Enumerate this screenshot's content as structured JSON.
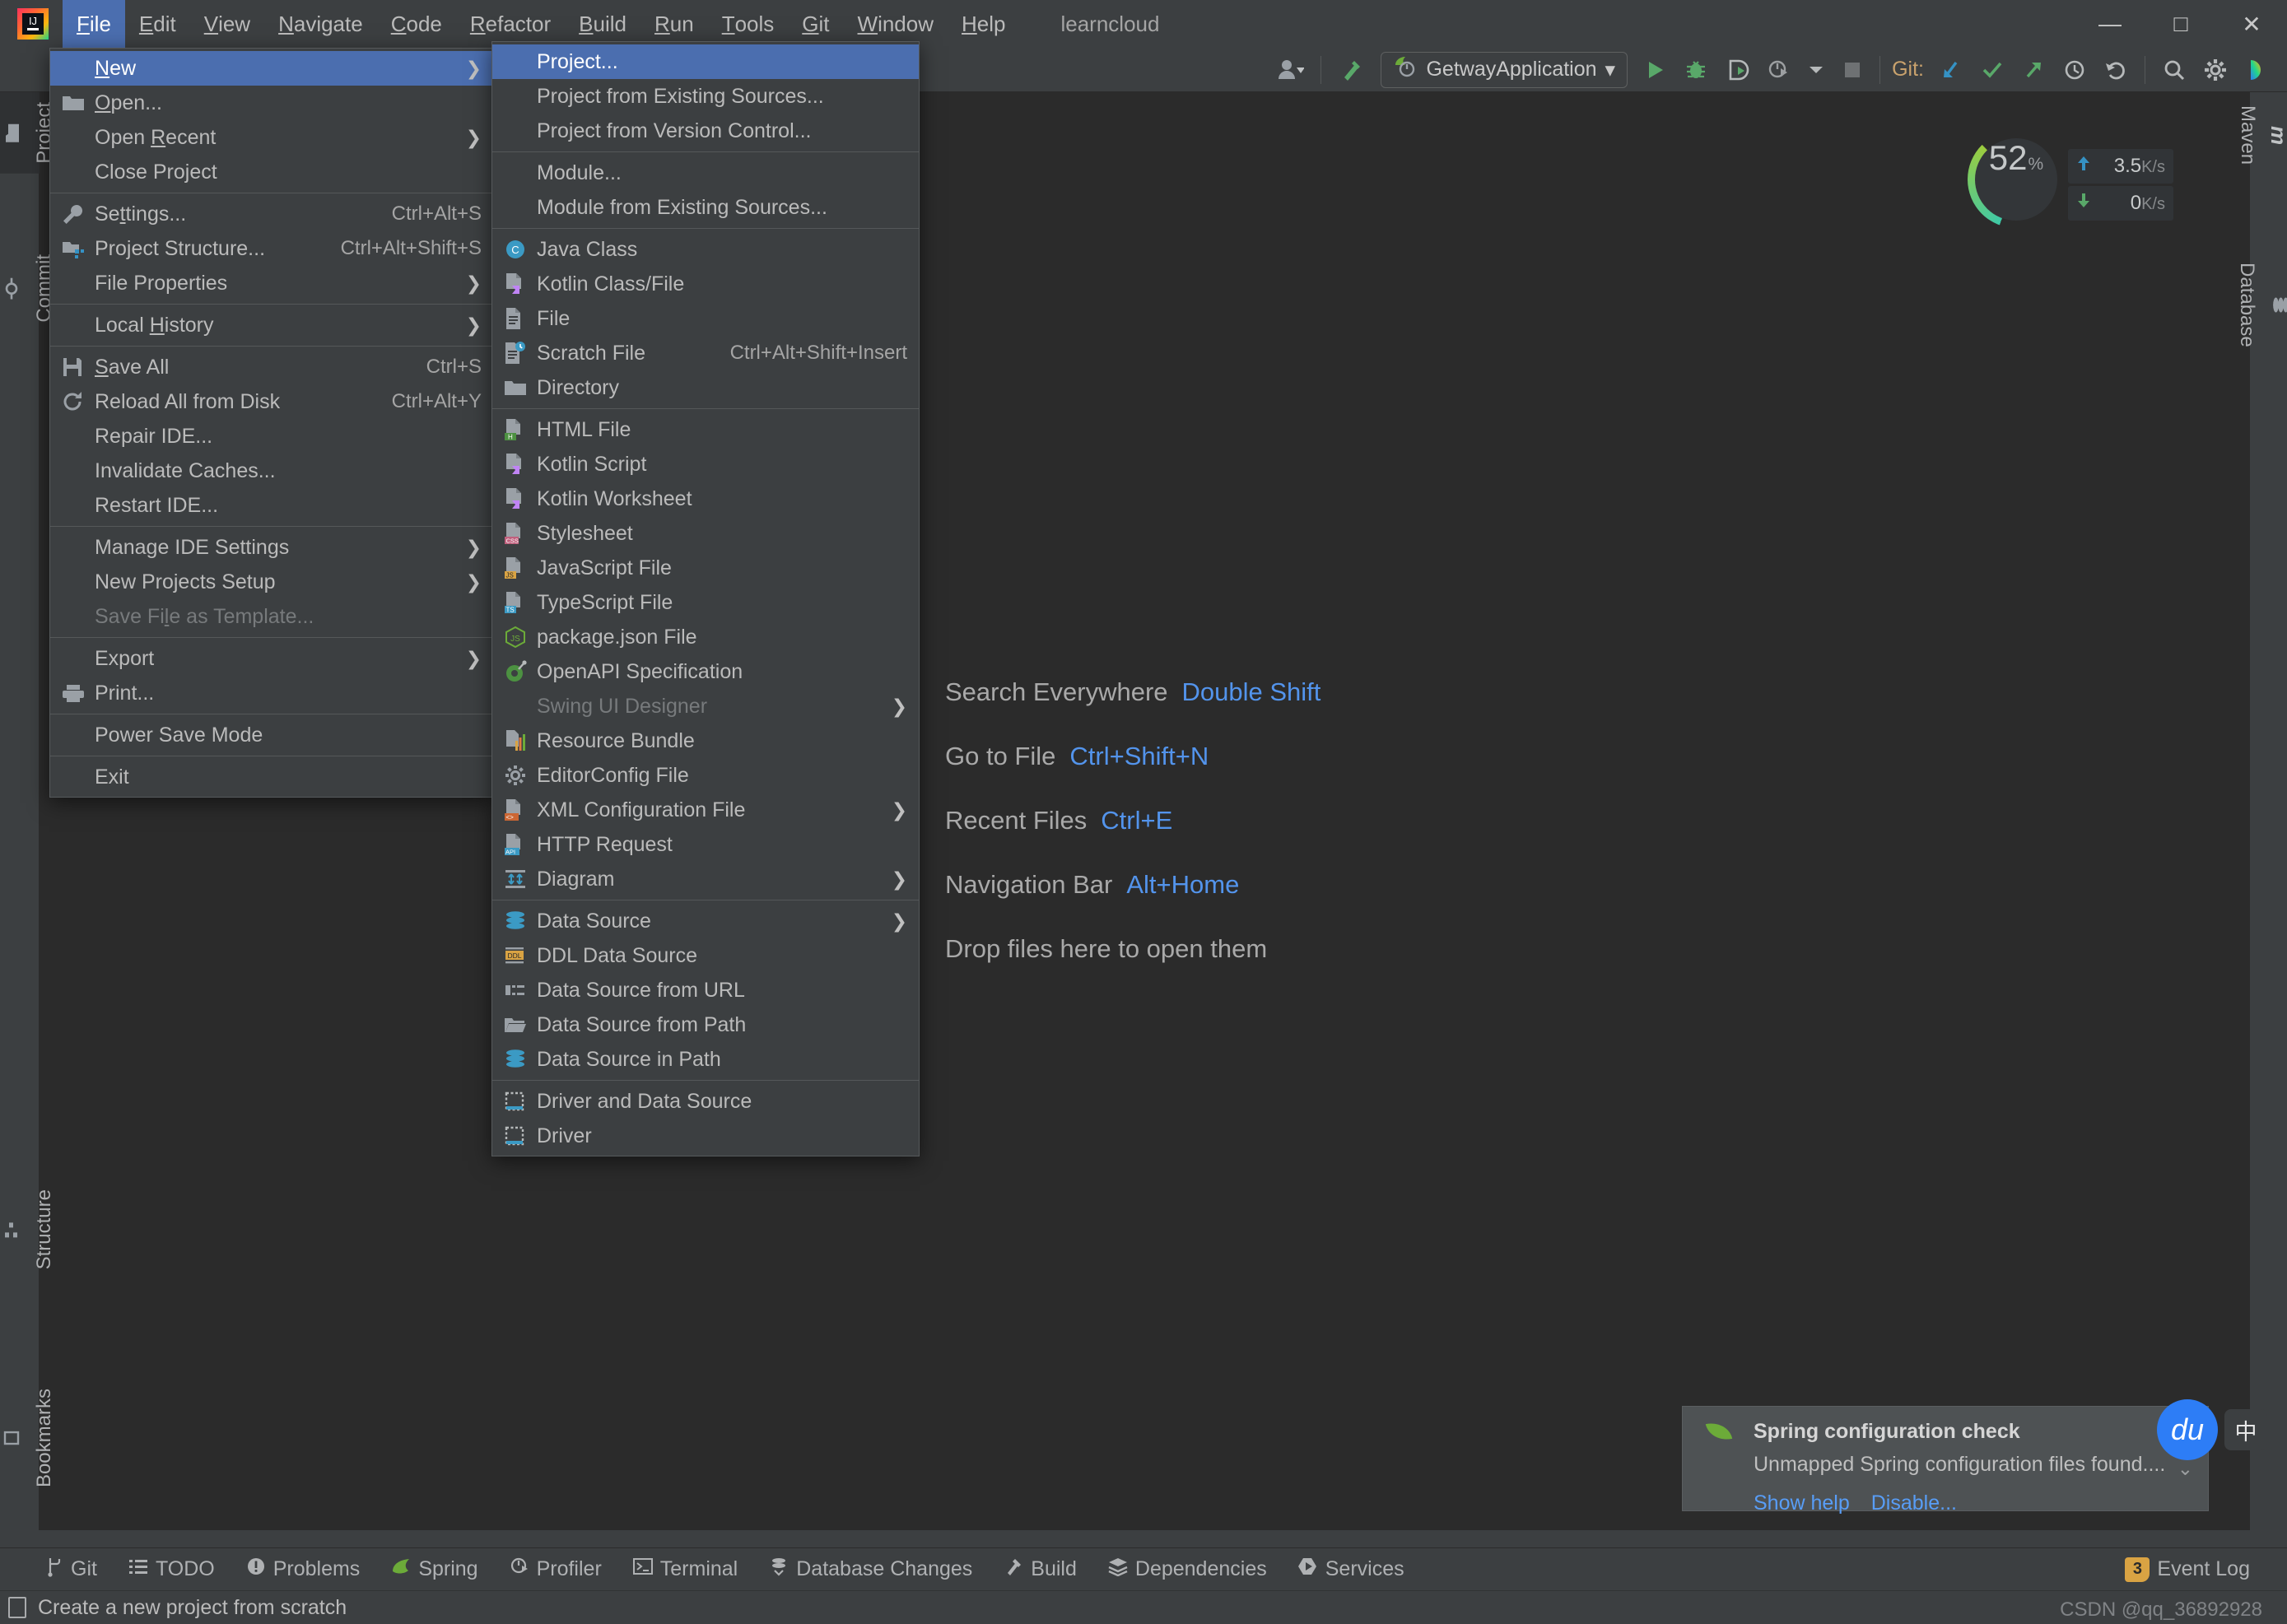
{
  "window": {
    "title": "learncloud",
    "logo_icon": "intellij-idea-logo",
    "minimize_label": "—",
    "maximize_label": "□",
    "close_label": "✕"
  },
  "menubar": {
    "items": [
      {
        "label": "File",
        "mnemonic": "F",
        "active": true
      },
      {
        "label": "Edit",
        "mnemonic": "E",
        "active": false
      },
      {
        "label": "View",
        "mnemonic": "V",
        "active": false
      },
      {
        "label": "Navigate",
        "mnemonic": "N",
        "active": false
      },
      {
        "label": "Code",
        "mnemonic": "C",
        "active": false
      },
      {
        "label": "Refactor",
        "mnemonic": "R",
        "active": false
      },
      {
        "label": "Build",
        "mnemonic": "B",
        "active": false
      },
      {
        "label": "Run",
        "mnemonic": "R",
        "active": false
      },
      {
        "label": "Tools",
        "mnemonic": "T",
        "active": false
      },
      {
        "label": "Git",
        "mnemonic": "G",
        "active": false
      },
      {
        "label": "Window",
        "mnemonic": "W",
        "active": false
      },
      {
        "label": "Help",
        "mnemonic": "H",
        "active": false
      }
    ]
  },
  "toolbar": {
    "account_icon": "user-account-icon",
    "build_icon": "build-hammer-icon",
    "run_config": {
      "name": "GetwayApplication",
      "icon": "spring-boot-icon",
      "chevron": "▾"
    },
    "run_icon": "run-play-icon",
    "debug_icon": "debug-bug-icon",
    "run_with_coverage_icon": "run-coverage-icon",
    "profile_icon": "profiler-icon",
    "stop_icon": "stop-square-icon",
    "git_label": "Git:",
    "git_update_icon": "git-update-arrow-icon",
    "git_commit_icon": "git-commit-check-icon",
    "git_push_icon": "git-push-arrow-icon",
    "git_history_icon": "git-history-clock-icon",
    "git_rollback_icon": "git-rollback-undo-icon",
    "search_icon": "search-magnifier-icon",
    "settings_icon": "settings-gear-icon",
    "ai_icon": "ai-assistant-icon"
  },
  "file_menu": {
    "items": [
      {
        "label": "New",
        "mnemonic": "N",
        "icon": "",
        "accel": "",
        "submenu": true,
        "highlighted": true,
        "disabled": false,
        "sep_after": false
      },
      {
        "label": "Open...",
        "mnemonic": "O",
        "icon": "folder-icon",
        "accel": "",
        "submenu": false,
        "highlighted": false,
        "disabled": false,
        "sep_after": false
      },
      {
        "label": "Open Recent",
        "mnemonic": "R",
        "icon": "",
        "accel": "",
        "submenu": true,
        "highlighted": false,
        "disabled": false,
        "sep_after": false
      },
      {
        "label": "Close Project",
        "mnemonic": "",
        "icon": "",
        "accel": "",
        "submenu": false,
        "highlighted": false,
        "disabled": false,
        "sep_after": true
      },
      {
        "label": "Settings...",
        "mnemonic": "t",
        "icon": "wrench-icon",
        "accel": "Ctrl+Alt+S",
        "submenu": false,
        "highlighted": false,
        "disabled": false,
        "sep_after": false
      },
      {
        "label": "Project Structure...",
        "mnemonic": "",
        "icon": "project-structure-icon",
        "accel": "Ctrl+Alt+Shift+S",
        "submenu": false,
        "highlighted": false,
        "disabled": false,
        "sep_after": false
      },
      {
        "label": "File Properties",
        "mnemonic": "",
        "icon": "",
        "accel": "",
        "submenu": true,
        "highlighted": false,
        "disabled": false,
        "sep_after": true
      },
      {
        "label": "Local History",
        "mnemonic": "H",
        "icon": "",
        "accel": "",
        "submenu": true,
        "highlighted": false,
        "disabled": false,
        "sep_after": true
      },
      {
        "label": "Save All",
        "mnemonic": "S",
        "icon": "save-floppy-icon",
        "accel": "Ctrl+S",
        "submenu": false,
        "highlighted": false,
        "disabled": false,
        "sep_after": false
      },
      {
        "label": "Reload All from Disk",
        "mnemonic": "",
        "icon": "reload-refresh-icon",
        "accel": "Ctrl+Alt+Y",
        "submenu": false,
        "highlighted": false,
        "disabled": false,
        "sep_after": false
      },
      {
        "label": "Repair IDE...",
        "mnemonic": "",
        "icon": "",
        "accel": "",
        "submenu": false,
        "highlighted": false,
        "disabled": false,
        "sep_after": false
      },
      {
        "label": "Invalidate Caches...",
        "mnemonic": "",
        "icon": "",
        "accel": "",
        "submenu": false,
        "highlighted": false,
        "disabled": false,
        "sep_after": false
      },
      {
        "label": "Restart IDE...",
        "mnemonic": "",
        "icon": "",
        "accel": "",
        "submenu": false,
        "highlighted": false,
        "disabled": false,
        "sep_after": true
      },
      {
        "label": "Manage IDE Settings",
        "mnemonic": "",
        "icon": "",
        "accel": "",
        "submenu": true,
        "highlighted": false,
        "disabled": false,
        "sep_after": false
      },
      {
        "label": "New Projects Setup",
        "mnemonic": "",
        "icon": "",
        "accel": "",
        "submenu": true,
        "highlighted": false,
        "disabled": false,
        "sep_after": false
      },
      {
        "label": "Save File as Template...",
        "mnemonic": "l",
        "icon": "",
        "accel": "",
        "submenu": false,
        "highlighted": false,
        "disabled": true,
        "sep_after": true
      },
      {
        "label": "Export",
        "mnemonic": "",
        "icon": "",
        "accel": "",
        "submenu": true,
        "highlighted": false,
        "disabled": false,
        "sep_after": false
      },
      {
        "label": "Print...",
        "mnemonic": "",
        "icon": "printer-icon",
        "accel": "",
        "submenu": false,
        "highlighted": false,
        "disabled": false,
        "sep_after": true
      },
      {
        "label": "Power Save Mode",
        "mnemonic": "",
        "icon": "",
        "accel": "",
        "submenu": false,
        "highlighted": false,
        "disabled": false,
        "sep_after": true
      },
      {
        "label": "Exit",
        "mnemonic": "",
        "icon": "",
        "accel": "",
        "submenu": false,
        "highlighted": false,
        "disabled": false,
        "sep_after": false
      }
    ]
  },
  "new_submenu": {
    "items": [
      {
        "label": "Project...",
        "icon": "",
        "accel": "",
        "submenu": false,
        "highlighted": true,
        "disabled": false,
        "sep_after": false
      },
      {
        "label": "Project from Existing Sources...",
        "icon": "",
        "accel": "",
        "submenu": false,
        "highlighted": false,
        "disabled": false,
        "sep_after": false
      },
      {
        "label": "Project from Version Control...",
        "icon": "",
        "accel": "",
        "submenu": false,
        "highlighted": false,
        "disabled": false,
        "sep_after": true
      },
      {
        "label": "Module...",
        "icon": "",
        "accel": "",
        "submenu": false,
        "highlighted": false,
        "disabled": false,
        "sep_after": false
      },
      {
        "label": "Module from Existing Sources...",
        "icon": "",
        "accel": "",
        "submenu": false,
        "highlighted": false,
        "disabled": false,
        "sep_after": true
      },
      {
        "label": "Java Class",
        "icon": "java-class-icon",
        "accel": "",
        "submenu": false,
        "highlighted": false,
        "disabled": false,
        "sep_after": false
      },
      {
        "label": "Kotlin Class/File",
        "icon": "kotlin-file-icon",
        "accel": "",
        "submenu": false,
        "highlighted": false,
        "disabled": false,
        "sep_after": false
      },
      {
        "label": "File",
        "icon": "file-icon",
        "accel": "",
        "submenu": false,
        "highlighted": false,
        "disabled": false,
        "sep_after": false
      },
      {
        "label": "Scratch File",
        "icon": "scratch-file-icon",
        "accel": "Ctrl+Alt+Shift+Insert",
        "submenu": false,
        "highlighted": false,
        "disabled": false,
        "sep_after": false
      },
      {
        "label": "Directory",
        "icon": "directory-folder-icon",
        "accel": "",
        "submenu": false,
        "highlighted": false,
        "disabled": false,
        "sep_after": true
      },
      {
        "label": "HTML File",
        "icon": "html-file-icon",
        "accel": "",
        "submenu": false,
        "highlighted": false,
        "disabled": false,
        "sep_after": false
      },
      {
        "label": "Kotlin Script",
        "icon": "kotlin-script-icon",
        "accel": "",
        "submenu": false,
        "highlighted": false,
        "disabled": false,
        "sep_after": false
      },
      {
        "label": "Kotlin Worksheet",
        "icon": "kotlin-worksheet-icon",
        "accel": "",
        "submenu": false,
        "highlighted": false,
        "disabled": false,
        "sep_after": false
      },
      {
        "label": "Stylesheet",
        "icon": "css-file-icon",
        "accel": "",
        "submenu": false,
        "highlighted": false,
        "disabled": false,
        "sep_after": false
      },
      {
        "label": "JavaScript File",
        "icon": "js-file-icon",
        "accel": "",
        "submenu": false,
        "highlighted": false,
        "disabled": false,
        "sep_after": false
      },
      {
        "label": "TypeScript File",
        "icon": "ts-file-icon",
        "accel": "",
        "submenu": false,
        "highlighted": false,
        "disabled": false,
        "sep_after": false
      },
      {
        "label": "package.json File",
        "icon": "nodejs-icon",
        "accel": "",
        "submenu": false,
        "highlighted": false,
        "disabled": false,
        "sep_after": false
      },
      {
        "label": "OpenAPI Specification",
        "icon": "openapi-icon",
        "accel": "",
        "submenu": false,
        "highlighted": false,
        "disabled": false,
        "sep_after": false
      },
      {
        "label": "Swing UI Designer",
        "icon": "",
        "accel": "",
        "submenu": true,
        "highlighted": false,
        "disabled": true,
        "sep_after": false
      },
      {
        "label": "Resource Bundle",
        "icon": "resource-bundle-icon",
        "accel": "",
        "submenu": false,
        "highlighted": false,
        "disabled": false,
        "sep_after": false
      },
      {
        "label": "EditorConfig File",
        "icon": "editorconfig-gear-icon",
        "accel": "",
        "submenu": false,
        "highlighted": false,
        "disabled": false,
        "sep_after": false
      },
      {
        "label": "XML Configuration File",
        "icon": "xml-file-icon",
        "accel": "",
        "submenu": true,
        "highlighted": false,
        "disabled": false,
        "sep_after": false
      },
      {
        "label": "HTTP Request",
        "icon": "http-request-icon",
        "accel": "",
        "submenu": false,
        "highlighted": false,
        "disabled": false,
        "sep_after": false
      },
      {
        "label": "Diagram",
        "icon": "diagram-icon",
        "accel": "",
        "submenu": true,
        "highlighted": false,
        "disabled": false,
        "sep_after": true
      },
      {
        "label": "Data Source",
        "icon": "data-source-icon",
        "accel": "",
        "submenu": true,
        "highlighted": false,
        "disabled": false,
        "sep_after": false
      },
      {
        "label": "DDL Data Source",
        "icon": "ddl-data-source-icon",
        "accel": "",
        "submenu": false,
        "highlighted": false,
        "disabled": false,
        "sep_after": false
      },
      {
        "label": "Data Source from URL",
        "icon": "data-source-url-icon",
        "accel": "",
        "submenu": false,
        "highlighted": false,
        "disabled": false,
        "sep_after": false
      },
      {
        "label": "Data Source from Path",
        "icon": "folder-open-icon",
        "accel": "",
        "submenu": false,
        "highlighted": false,
        "disabled": false,
        "sep_after": false
      },
      {
        "label": "Data Source in Path",
        "icon": "data-source-icon",
        "accel": "",
        "submenu": false,
        "highlighted": false,
        "disabled": false,
        "sep_after": true
      },
      {
        "label": "Driver and Data Source",
        "icon": "driver-icon",
        "accel": "",
        "submenu": false,
        "highlighted": false,
        "disabled": false,
        "sep_after": false
      },
      {
        "label": "Driver",
        "icon": "driver-icon",
        "accel": "",
        "submenu": false,
        "highlighted": false,
        "disabled": false,
        "sep_after": false
      }
    ]
  },
  "left_stripe": {
    "items": [
      {
        "label": "Project",
        "icon": "project-folder-icon",
        "selected": true
      },
      {
        "label": "Commit",
        "icon": "commit-icon",
        "selected": false
      },
      {
        "label": "Structure",
        "icon": "structure-icon",
        "selected": false
      },
      {
        "label": "Bookmarks",
        "icon": "bookmarks-icon",
        "selected": false
      }
    ]
  },
  "right_stripe": {
    "items": [
      {
        "label": "Maven",
        "icon": "maven-m-icon"
      },
      {
        "label": "Database",
        "icon": "database-icon"
      }
    ]
  },
  "editor_hints": {
    "rows": [
      {
        "label": "Search Everywhere",
        "key": "Double Shift"
      },
      {
        "label": "Go to File",
        "key": "Ctrl+Shift+N"
      },
      {
        "label": "Recent Files",
        "key": "Ctrl+E"
      },
      {
        "label": "Navigation Bar",
        "key": "Alt+Home"
      },
      {
        "label": "Drop files here to open them",
        "key": ""
      }
    ]
  },
  "cpu_widget": {
    "cpu_percent": "52",
    "percent_symbol": "%",
    "upload_value": "3.5",
    "upload_unit": "K/s",
    "upload_icon": "upload-arrow-icon",
    "download_value": "0",
    "download_unit": "K/s",
    "download_icon": "download-arrow-icon",
    "gauge_color_start": "#3ec9a7",
    "gauge_color_end": "#9ccc3e"
  },
  "notification": {
    "icon": "spring-leaf-icon",
    "title": "Spring configuration check",
    "body": "Unmapped Spring configuration files found....",
    "links": [
      "Show help",
      "Disable..."
    ],
    "collapse_icon": "chevron-down-icon"
  },
  "floating": {
    "du_badge": "du",
    "ime_badge": "中"
  },
  "toolwindow_bar": {
    "items": [
      {
        "label": "Git",
        "icon": "git-branch-icon"
      },
      {
        "label": "TODO",
        "icon": "todo-list-icon"
      },
      {
        "label": "Problems",
        "icon": "problems-warning-icon"
      },
      {
        "label": "Spring",
        "icon": "spring-leaf-icon"
      },
      {
        "label": "Profiler",
        "icon": "profiler-icon"
      },
      {
        "label": "Terminal",
        "icon": "terminal-icon"
      },
      {
        "label": "Database Changes",
        "icon": "database-changes-icon"
      },
      {
        "label": "Build",
        "icon": "build-hammer-icon"
      },
      {
        "label": "Dependencies",
        "icon": "dependencies-icon"
      },
      {
        "label": "Services",
        "icon": "services-icon"
      }
    ],
    "event_log": {
      "label": "Event Log",
      "count": "3"
    }
  },
  "status_bar": {
    "icon": "status-document-icon",
    "message": "Create a new project from scratch",
    "watermark": "CSDN @qq_36892928"
  }
}
